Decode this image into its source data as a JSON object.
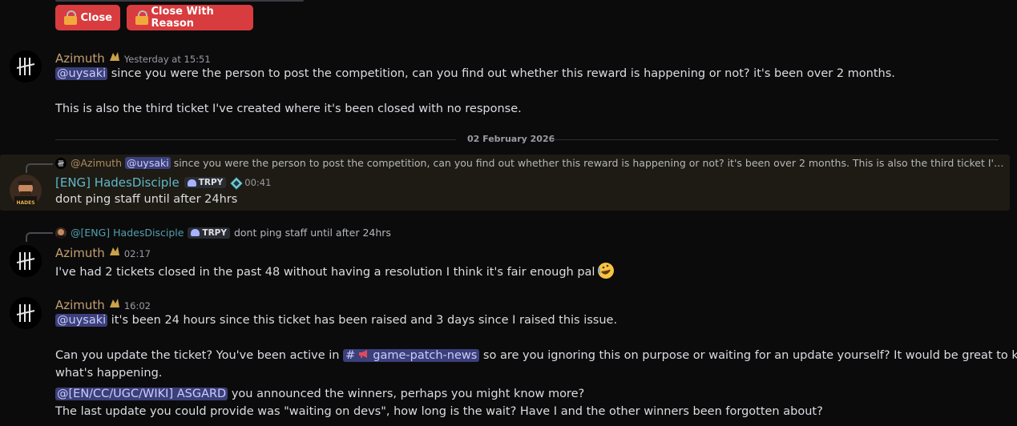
{
  "top_buttons": {
    "close": "Close",
    "close_with_reason": "Close With Reason"
  },
  "msg1": {
    "author": "Azimuth",
    "time": "Yesterday at 15:51",
    "mention": "@uysaki",
    "line1": " since you were the person to post the competition, can you find out whether this reward is happening or not? it's been over 2 months.",
    "line2": "This is also the third ticket I've created where it's been closed with no response."
  },
  "date_divider": "02 February 2026",
  "msg2": {
    "reply_author": "@Azimuth",
    "reply_mention": "@uysaki",
    "reply_text": " since you were the person to post the competition, can you find out whether this reward is happening or not? it's been over 2 months.  This is also the third ticket I've creat...",
    "author": "[ENG] HadesDisciple",
    "tag": "TRPY",
    "time": "00:41",
    "text": "dont ping staff until after 24hrs",
    "avatar_label": "HADES"
  },
  "msg3": {
    "reply_author": "@[ENG] HadesDisciple",
    "reply_tag": "TRPY",
    "reply_text": "dont ping staff until after 24hrs",
    "author": "Azimuth",
    "time": "02:17",
    "text": "I've had 2 tickets closed in the past 48 without having a resolution I think it's fair enough pal"
  },
  "msg4": {
    "author": "Azimuth",
    "time": "16:02",
    "mention1": "@uysaki",
    "line1": " it's been 24 hours since this ticket has been raised and 3 days since I raised this issue.",
    "line2a": "Can you update the ticket? You've been active in ",
    "channel": "game-patch-news",
    "line2b": " so are you ignoring this on purpose or waiting for an update yourself? It would be great to know",
    "line3": "what's happening.",
    "mention2": "@[EN/CC/UGC/WIKI] ASGARD",
    "line4": " you announced the winners, perhaps you might know more?",
    "line5": "The last update you could provide was \"waiting on devs\", how long is the wait? Have I and the other winners been forgotten about?"
  },
  "colors": {
    "background": "#0b0b0c",
    "danger_button": "#d83c3e",
    "mention_bg": "#3b3f7a",
    "azimuth_name": "#c59f6f",
    "hades_name": "#5fb8c9",
    "highlight_bg": "#1e1b14"
  }
}
